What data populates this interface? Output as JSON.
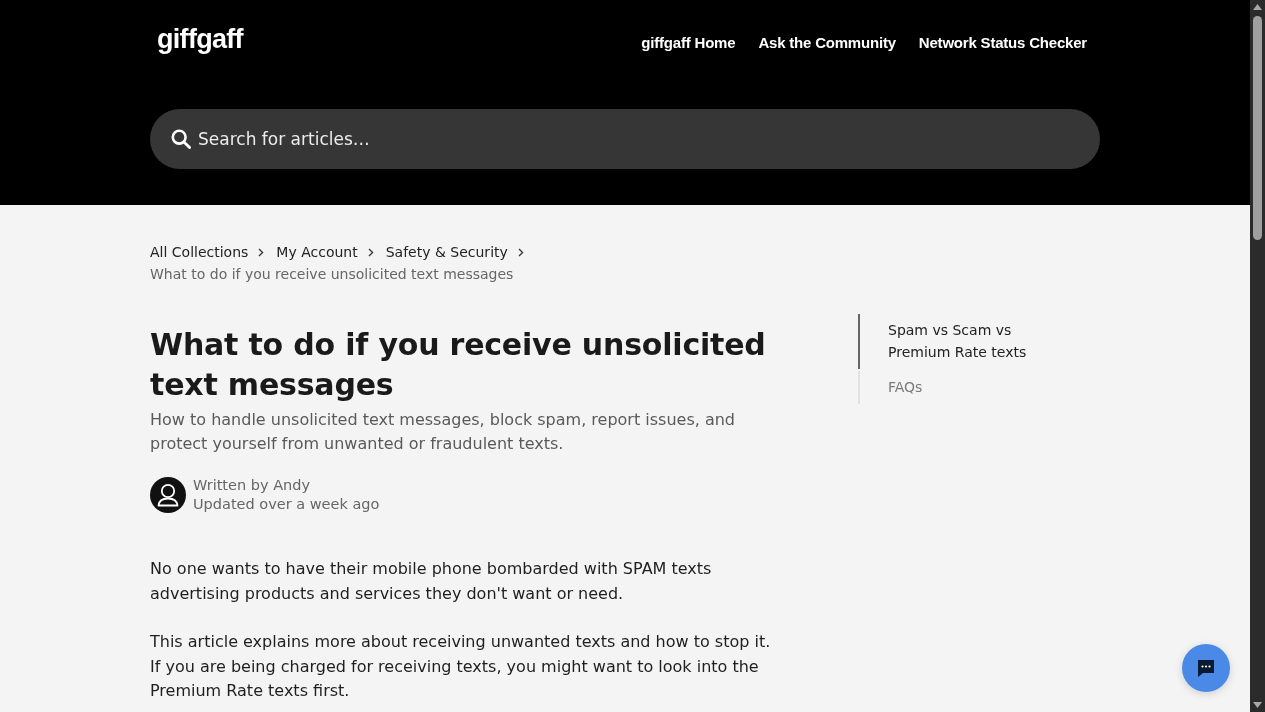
{
  "header": {
    "logo": "giffgaff",
    "nav": [
      "giffgaff Home",
      "Ask the Community",
      "Network Status Checker"
    ],
    "search": {
      "placeholder": "Search for articles…"
    }
  },
  "breadcrumb": {
    "links": [
      "All Collections",
      "My Account",
      "Safety & Security"
    ],
    "current": "What to do if you receive unsolicited text messages"
  },
  "article": {
    "title": "What to do if you receive unsolicited text messages",
    "subtitle": "How to handle unsolicited text messages, block spam, report issues, and protect yourself from unwanted or fraudulent texts.",
    "author": {
      "written_by": "Written by Andy",
      "updated": "Updated over a week ago"
    },
    "paragraphs": [
      "No one wants to have their mobile phone bombarded with SPAM texts advertising products and services they don't want or need.",
      "This article explains more about receiving unwanted texts and how to stop it.\nIf you are being charged for receiving texts, you might want to look into the Premium Rate texts first."
    ]
  },
  "toc": [
    {
      "label": "Spam vs Scam vs Premium Rate texts",
      "selected": true
    },
    {
      "label": "FAQs",
      "selected": false
    }
  ]
}
